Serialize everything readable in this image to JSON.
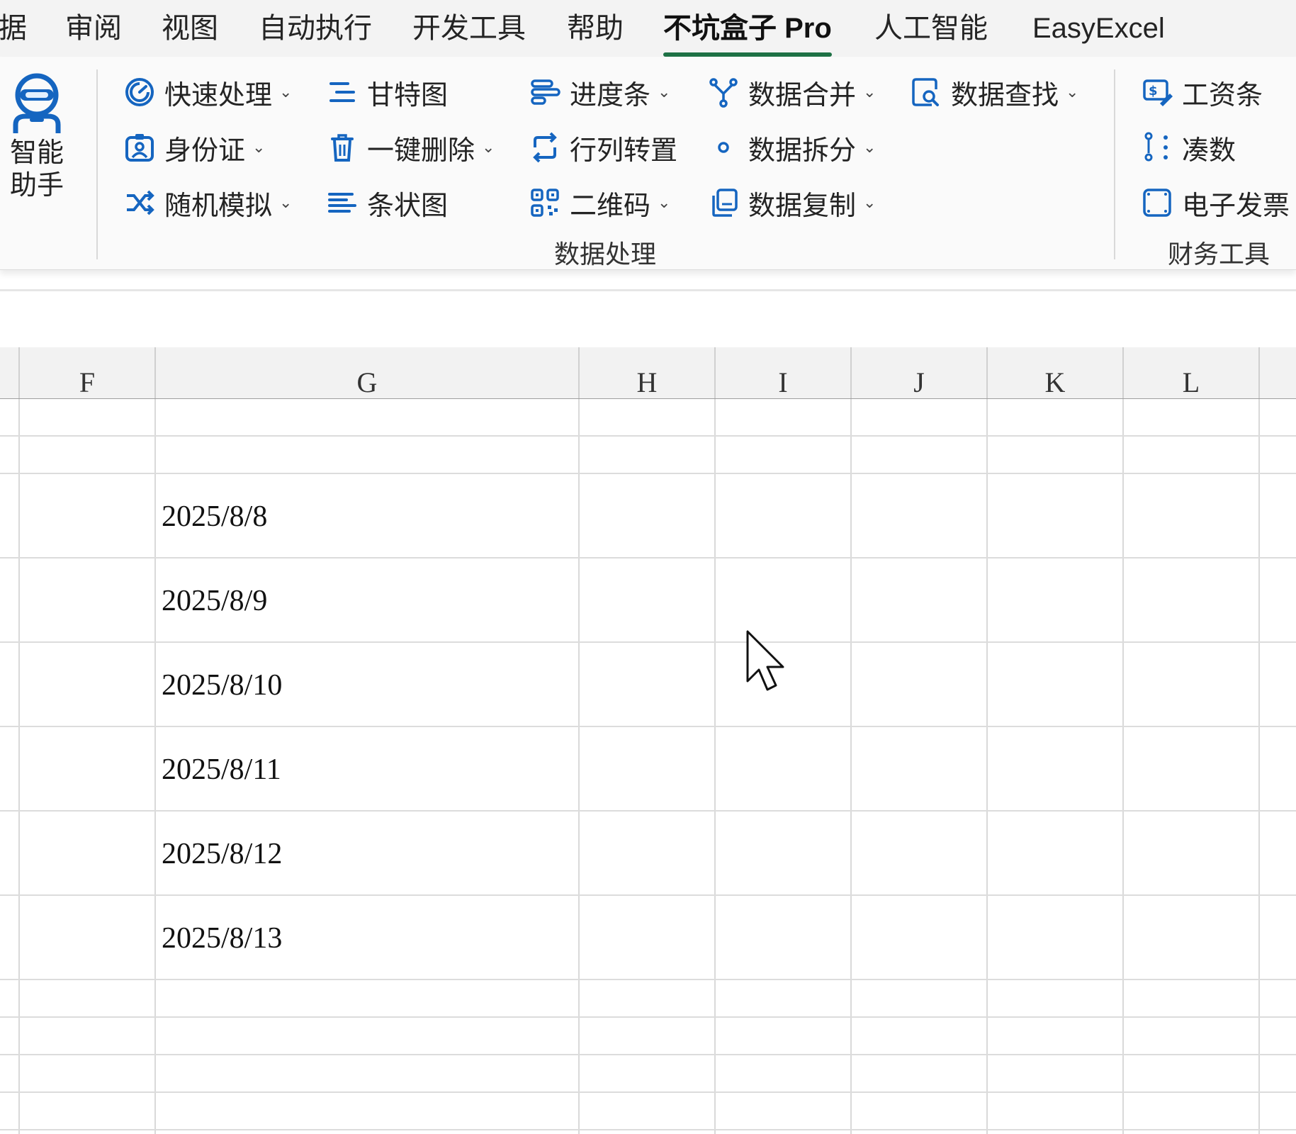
{
  "tabs": [
    "据",
    "审阅",
    "视图",
    "自动执行",
    "开发工具",
    "帮助",
    "不坑盒子 Pro",
    "人工智能",
    "EasyExcel"
  ],
  "active_tab": "不坑盒子 Pro",
  "ribbon": {
    "assistant": {
      "line1": "智能",
      "line2": "助手",
      "icon": "robot-assistant-icon"
    },
    "data_group": {
      "label": "数据处理",
      "col1": [
        {
          "label": "快速处理",
          "icon": "quick-process-icon",
          "dropdown": true
        },
        {
          "label": "身份证",
          "icon": "id-card-icon",
          "dropdown": true
        },
        {
          "label": "随机模拟",
          "icon": "shuffle-icon",
          "dropdown": true
        }
      ],
      "col2": [
        {
          "label": "甘特图",
          "icon": "gantt-icon",
          "dropdown": false
        },
        {
          "label": "一键删除",
          "icon": "trash-icon",
          "dropdown": true
        },
        {
          "label": "条状图",
          "icon": "bar-chart-icon",
          "dropdown": false
        }
      ],
      "col3": [
        {
          "label": "进度条",
          "icon": "progress-bar-icon",
          "dropdown": true
        },
        {
          "label": "行列转置",
          "icon": "transpose-icon",
          "dropdown": false
        },
        {
          "label": "二维码",
          "icon": "qr-code-icon",
          "dropdown": true
        }
      ],
      "col4": [
        {
          "label": "数据合并",
          "icon": "merge-icon",
          "dropdown": true
        },
        {
          "label": "数据拆分",
          "icon": "split-icon",
          "dropdown": true
        },
        {
          "label": "数据复制",
          "icon": "copy-icon",
          "dropdown": true
        }
      ],
      "col5": [
        {
          "label": "数据查找",
          "icon": "search-doc-icon",
          "dropdown": true
        }
      ]
    },
    "finance_group": {
      "label": "财务工具",
      "items": [
        {
          "label": "工资条",
          "icon": "salary-icon"
        },
        {
          "label": "凑数",
          "icon": "dots-icon"
        },
        {
          "label": "电子发票",
          "icon": "invoice-icon"
        }
      ]
    }
  },
  "sheet": {
    "columns": [
      "F",
      "G",
      "H",
      "I",
      "J",
      "K",
      "L"
    ],
    "cells": [
      "2025/8/8",
      "2025/8/9",
      "2025/8/10",
      "2025/8/11",
      "2025/8/12",
      "2025/8/13"
    ]
  },
  "colors": {
    "accent_green": "#1e7145",
    "icon_blue": "#1565c0"
  }
}
